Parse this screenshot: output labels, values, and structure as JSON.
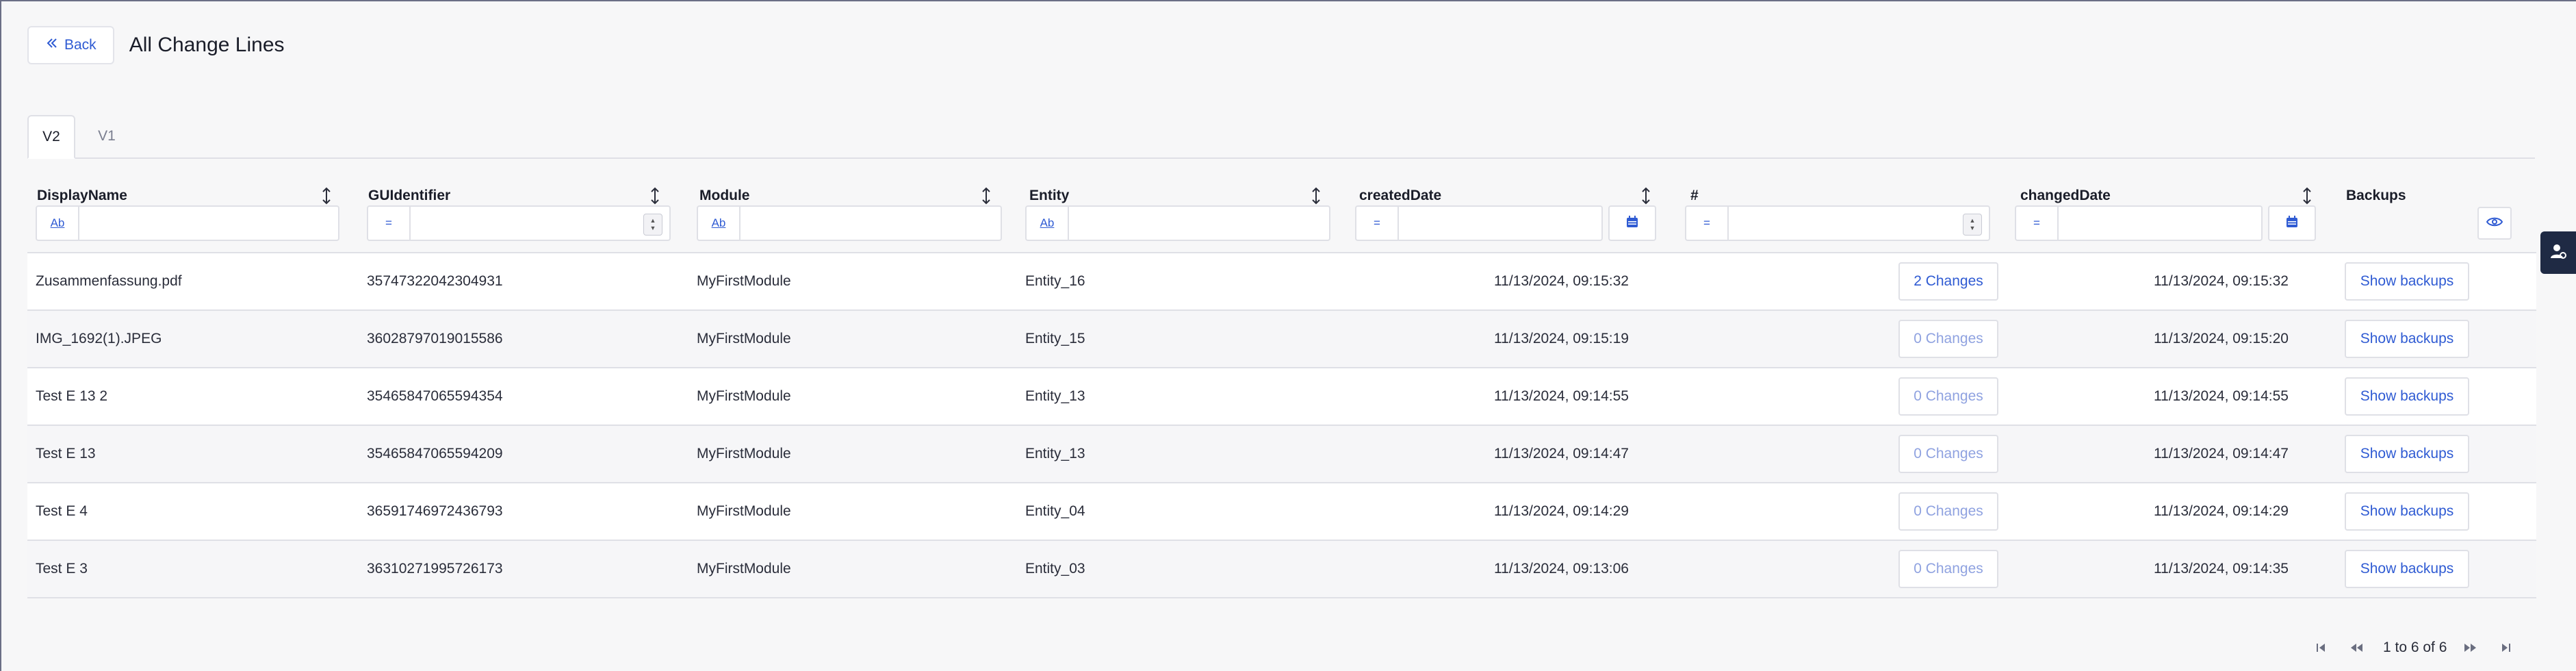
{
  "header": {
    "back_label": "Back",
    "title": "All Change Lines"
  },
  "tabs": [
    {
      "label": "V2"
    },
    {
      "label": "V1"
    }
  ],
  "columns": [
    {
      "title": "DisplayName",
      "filter_op": "Ab"
    },
    {
      "title": "GUIdentifier",
      "filter_op": "="
    },
    {
      "title": "Module",
      "filter_op": "Ab"
    },
    {
      "title": "Entity",
      "filter_op": "Ab"
    },
    {
      "title": "createdDate",
      "filter_op": "="
    },
    {
      "title": "#",
      "filter_op": "="
    },
    {
      "title": "changedDate",
      "filter_op": "="
    },
    {
      "title": "Backups"
    }
  ],
  "rows": [
    {
      "display_name": "Zusammenfassung.pdf",
      "guid": "35747322042304931",
      "module": "MyFirstModule",
      "entity": "Entity_16",
      "created": "11/13/2024, 09:15:32",
      "changes": "2 Changes",
      "changed": "11/13/2024, 09:15:32",
      "backups": "Show backups"
    },
    {
      "display_name": "IMG_1692(1).JPEG",
      "guid": "36028797019015586",
      "module": "MyFirstModule",
      "entity": "Entity_15",
      "created": "11/13/2024, 09:15:19",
      "changes": "0 Changes",
      "changed": "11/13/2024, 09:15:20",
      "backups": "Show backups"
    },
    {
      "display_name": "Test E 13 2",
      "guid": "35465847065594354",
      "module": "MyFirstModule",
      "entity": "Entity_13",
      "created": "11/13/2024, 09:14:55",
      "changes": "0 Changes",
      "changed": "11/13/2024, 09:14:55",
      "backups": "Show backups"
    },
    {
      "display_name": "Test E 13",
      "guid": "35465847065594209",
      "module": "MyFirstModule",
      "entity": "Entity_13",
      "created": "11/13/2024, 09:14:47",
      "changes": "0 Changes",
      "changed": "11/13/2024, 09:14:47",
      "backups": "Show backups"
    },
    {
      "display_name": "Test E 4",
      "guid": "36591746972436793",
      "module": "MyFirstModule",
      "entity": "Entity_04",
      "created": "11/13/2024, 09:14:29",
      "changes": "0 Changes",
      "changed": "11/13/2024, 09:14:29",
      "backups": "Show backups"
    },
    {
      "display_name": "Test E 3",
      "guid": "36310271995726173",
      "module": "MyFirstModule",
      "entity": "Entity_03",
      "created": "11/13/2024, 09:13:06",
      "changes": "0 Changes",
      "changed": "11/13/2024, 09:14:35",
      "backups": "Show backups"
    }
  ],
  "pager": {
    "text": "1 to 6 of 6"
  },
  "icons": {
    "back": "chevrons-left-icon",
    "sort": "sort-arrows-icon",
    "calendar": "calendar-icon",
    "eye": "eye-icon",
    "first": "first-page-icon",
    "prev": "prev-page-icon",
    "next": "next-page-icon",
    "last": "last-page-icon",
    "side": "user-settings-icon"
  },
  "colors": {
    "accent": "#2f5bd3",
    "muted_accent": "#8fa2e0",
    "side_tab": "#1f2a44"
  }
}
